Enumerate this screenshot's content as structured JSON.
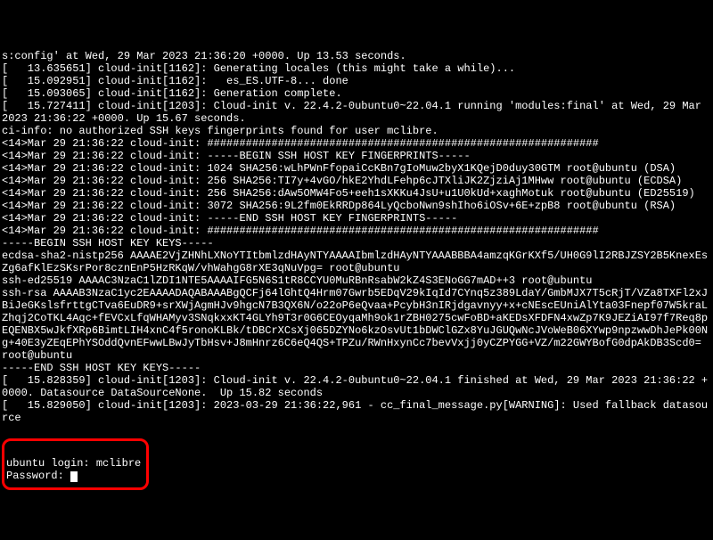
{
  "lines": [
    "s:config' at Wed, 29 Mar 2023 21:36:20 +0000. Up 13.53 seconds.",
    "[   13.635651] cloud-init[1162]: Generating locales (this might take a while)...",
    "[   15.092951] cloud-init[1162]:   es_ES.UTF-8... done",
    "[   15.093065] cloud-init[1162]: Generation complete.",
    "[   15.727411] cloud-init[1203]: Cloud-init v. 22.4.2-0ubuntu0~22.04.1 running 'modules:final' at Wed, 29 Mar 2023 21:36:22 +0000. Up 15.67 seconds.",
    "ci-info: no authorized SSH keys fingerprints found for user mclibre.",
    "<14>Mar 29 21:36:22 cloud-init: #############################################################",
    "<14>Mar 29 21:36:22 cloud-init: -----BEGIN SSH HOST KEY FINGERPRINTS-----",
    "<14>Mar 29 21:36:22 cloud-init: 1024 SHA256:wLhPWnFfopaiCcKBn7gIoMuw2byX1KQejD0duy30GTM root@ubuntu (DSA)",
    "<14>Mar 29 21:36:22 cloud-init: 256 SHA256:TI7y+4vGO/hkE2YhdLFehp6cJTXliJK2ZjziAj1MHww root@ubuntu (ECDSA)",
    "<14>Mar 29 21:36:22 cloud-init: 256 SHA256:dAw5OMW4Fo5+eeh1sXKKu4JsU+u1U0kUd+xaghMotuk root@ubuntu (ED25519)",
    "<14>Mar 29 21:36:22 cloud-init: 3072 SHA256:9L2fm0EkRRDp864LyQcboNwn9shIho6iOSv+6E+zpB8 root@ubuntu (RSA)",
    "<14>Mar 29 21:36:22 cloud-init: -----END SSH HOST KEY FINGERPRINTS-----",
    "<14>Mar 29 21:36:22 cloud-init: #############################################################",
    "-----BEGIN SSH HOST KEY KEYS-----",
    "ecdsa-sha2-nistp256 AAAAE2VjZHNhLXNoYTItbmlzdHAyNTYAAAAIbmlzdHAyNTYAAABBBA4amzqKGrKXf5/UH0G9lI2RBJZSY2B5KnexEsZg6afKlEzSKsrPor8cznEnP5HzRKqW/vhWahgG8rXE3qNuVpg= root@ubuntu",
    "ssh-ed25519 AAAAC3NzaC1lZDI1NTE5AAAAIFG5N6S1tR8CCYU0MuRBnRsabW2kZ4S3ENoGG7mAD++3 root@ubuntu",
    "ssh-rsa AAAAB3NzaC1yc2EAAAADAQABAAABgQCFj64lGhtQ4Hrm07Gwrb5EDqV29kIqId7CYnq5z389LdaY/GmbMJX7T5cRjT/VZa8TXFl2xJBiJeGKslsfrttgCTva6EuDR9+srXWjAgmHJv9hgcN7B3QX6N/o22oP6eQvaa+PcybH3nIRjdgavnyy+x+cNEscEUniAlYta03Fnepf07W5kraLZhqj2CoTKL4Aqc+fEVCxLfqWHAMyv3SNqkxxKT4GLYh9T3r0G6CEOyqaMh9ok1rZBH0275cwFoBD+aKEDsXFDFN4xwZp7K9JEZiAI97f7Req8pEQENBX5wJkfXRp6BimtLIH4xnC4f5ronoKLBk/tDBCrXCsXj065DZYNo6kzOsvUt1bDWClGZx8YuJGUQwNcJVoWeB06XYwp9npzwwDhJePk00Ng+40E3yZEqEPhYSOddQvnEFwwLBwJyTbHsv+J8mHnrz6C6eQ4QS+TPZu/RWnHxynCc7bevVxjj0yCZPYGG+VZ/m22GWYBofG0dpAkDB3Scd0= root@ubuntu",
    "-----END SSH HOST KEY KEYS-----",
    "[   15.828359] cloud-init[1203]: Cloud-init v. 22.4.2-0ubuntu0~22.04.1 finished at Wed, 29 Mar 2023 21:36:22 +0000. Datasource DataSourceNone.  Up 15.82 seconds",
    "[   15.829050] cloud-init[1203]: 2023-03-29 21:36:22,961 - cc_final_message.py[WARNING]: Used fallback datasource"
  ],
  "login_prompt": "ubuntu login: ",
  "login_value": "mclibre",
  "password_prompt": "Password: "
}
